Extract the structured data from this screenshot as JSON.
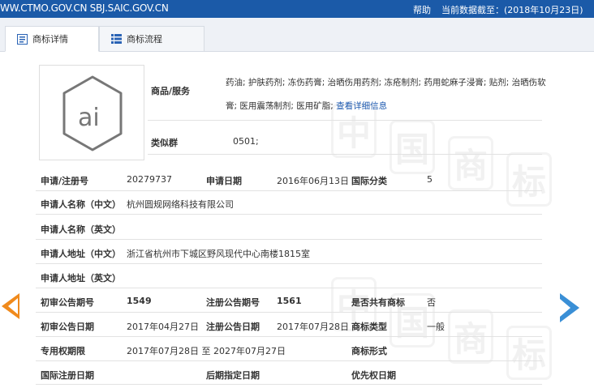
{
  "header": {
    "site_urls": "WW.CTMO.GOV.CN SBJ.SAIC.GOV.CN",
    "help": "帮助",
    "data_date": "当前数据截至：(2018年10月23日)"
  },
  "tabs": [
    {
      "label": "商标详情",
      "active": true
    },
    {
      "label": "商标流程",
      "active": false
    }
  ],
  "trademark": {
    "logo_text": "ai",
    "goods_label": "商品/服务",
    "goods_line1": "药油; 护肤药剂; 冻伤药膏; 治晒伤用药剂; 冻疮制剂; 药用蛇麻子浸膏; 贴剂; 治晒伤软",
    "goods_line2": "膏; 医用震荡制剂; 医用矿脂;",
    "goods_more": "查看详细信息",
    "similar_group_label": "类似群",
    "similar_group_value": "0501;",
    "reg_no_label": "申请/注册号",
    "reg_no": "20279737",
    "apply_date_label": "申请日期",
    "apply_date": "2016年06月13日",
    "intl_class_label": "国际分类",
    "intl_class": "5",
    "applicant_cn_label": "申请人名称（中文）",
    "applicant_cn": "杭州圆规网络科技有限公司",
    "applicant_en_label": "申请人名称（英文）",
    "applicant_en": "",
    "address_cn_label": "申请人地址（中文）",
    "address_cn": "浙江省杭州市下城区野风现代中心南楼1815室",
    "address_en_label": "申请人地址（英文）",
    "address_en": "",
    "prelim_no_label": "初审公告期号",
    "prelim_no": "1549",
    "reg_ann_no_label": "注册公告期号",
    "reg_ann_no": "1561",
    "shared_label": "是否共有商标",
    "shared": "否",
    "prelim_date_label": "初审公告日期",
    "prelim_date": "2017年04月27日",
    "reg_ann_date_label": "注册公告日期",
    "reg_ann_date": "2017年07月28日",
    "tm_type_label": "商标类型",
    "tm_type": "一般",
    "exclusive_label": "专用权期限",
    "exclusive": "2017年07月28日 至 2027年07月27日",
    "tm_form_label": "商标形式",
    "tm_form": "",
    "intl_reg_date_label": "国际注册日期",
    "later_date_label": "后期指定日期",
    "priority_date_label": "优先权日期"
  },
  "colors": {
    "topbar": "#1b5aa8",
    "link": "#1d5ab0",
    "prev_arrow": "#f08a1c",
    "next_arrow": "#3a8fd6"
  }
}
